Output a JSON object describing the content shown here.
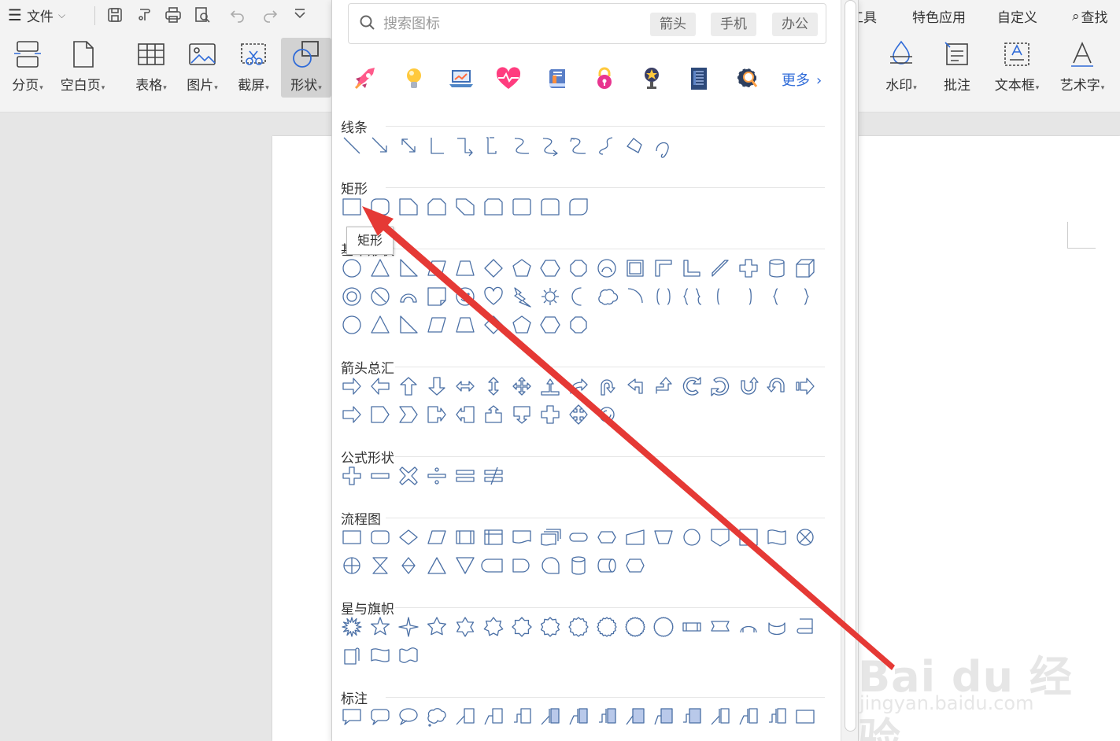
{
  "ribbon": {
    "menu_label": "文件",
    "left_buttons": [
      {
        "label": "分页"
      },
      {
        "label": "空白页"
      },
      {
        "label": "表格"
      },
      {
        "label": "图片"
      },
      {
        "label": "截屏"
      },
      {
        "label": "形状"
      }
    ],
    "right_tabs": [
      {
        "label": "工具"
      },
      {
        "label": "特色应用"
      },
      {
        "label": "自定义"
      },
      {
        "label": "查找"
      }
    ],
    "right_buttons": [
      {
        "label": "水印"
      },
      {
        "label": "批注"
      },
      {
        "label": "文本框"
      },
      {
        "label": "艺术字"
      }
    ],
    "dropdown_mark": "▾"
  },
  "panel": {
    "search": {
      "placeholder": "搜索图标",
      "chips": [
        "箭头",
        "手机",
        "办公"
      ]
    },
    "icons": [
      "rocket-icon",
      "lightbulb-icon",
      "laptop-chart-icon",
      "heart-pulse-icon",
      "book-icon",
      "lock-icon",
      "trophy-icon",
      "document-icon",
      "gear-search-icon"
    ],
    "more_label": "更多",
    "sections": [
      {
        "title": "线条"
      },
      {
        "title": "矩形"
      },
      {
        "title": "基本形状"
      },
      {
        "title": "箭头总汇"
      },
      {
        "title": "公式形状"
      },
      {
        "title": "流程图"
      },
      {
        "title": "星与旗帜"
      },
      {
        "title": "标注"
      }
    ],
    "tooltip": "矩形"
  },
  "watermark": {
    "line1": "Bai du 经验",
    "line2": "jingyan.baidu.com"
  },
  "colors": {
    "shape_stroke": "#4a6fa5",
    "arrow": "#e53935",
    "accent": "#2f6bd8"
  }
}
